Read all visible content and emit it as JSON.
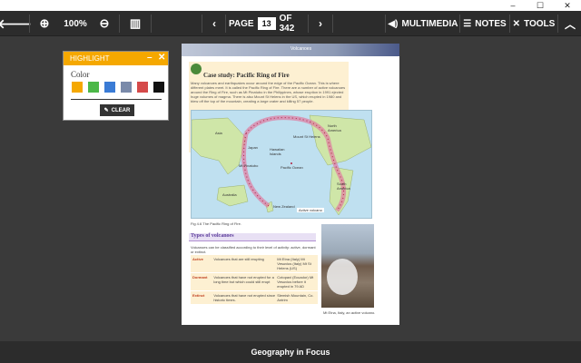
{
  "window": {
    "minimize": "–",
    "maximize": "☐",
    "close": "✕"
  },
  "toolbar": {
    "back": "🡐",
    "zoom_in": "⊕",
    "zoom_level": "100%",
    "zoom_out": "⊖",
    "book_view": "▥",
    "page_label": "PAGE",
    "page_number": "13",
    "page_of": "OF 342",
    "multimedia": "MULTIMEDIA",
    "notes": "NOTES",
    "tools": "TOOLS"
  },
  "highlight": {
    "title": "HIGHLIGHT",
    "color_label": "Color",
    "colors": [
      "#f5a800",
      "#4cb848",
      "#3a7bd5",
      "#7a8aaa",
      "#d54a4a",
      "#111111"
    ],
    "clear_label": "CLEAR"
  },
  "book": {
    "banner": "Volcanoes",
    "cs_title": "Case study: Pacific Ring of Fire",
    "cs_text": "Many volcanoes and earthquakes occur around the edge of the Pacific Ocean. This is where different plates meet. It is called the Pacific Ring of Fire. There are a number of active volcanoes around the Ring of Fire, such as Mt Pinatubo in the Philippines, whose eruption in 1991 ejected huge volumes of magma. There is also Mount St Helens in the US, which erupted in 1980 and blew off the top of the mountain, creating a large crater and killing 57 people.",
    "map_labels": [
      "Asia",
      "North America",
      "Mount St Helens",
      "Hawaiian Islands",
      "Pacific Ocean",
      "Mt Pinatubo",
      "Japan",
      "South America",
      "Australia",
      "New Zealand",
      "Active volcano"
    ],
    "fig_caption": "Fig 4.6 The Pacific Ring of Fire.",
    "tv_title": "Types of volcanoes",
    "tv_intro": "Volcanoes can be classified according to their level of activity: active, dormant or extinct.",
    "table": [
      {
        "type": "Active",
        "desc": "Volcanoes that are still erupting",
        "examples": "Mt Etna (Italy) Mt Vesuvius (Italy) Mt St Helens (US)"
      },
      {
        "type": "Dormant",
        "desc": "Volcanoes that have not erupted for a long time but which could still erupt",
        "examples": "Cotopaxi (Ecuador) Mt Vesuvius before it erupted in 79 AD"
      },
      {
        "type": "Extinct",
        "desc": "Volcanoes that have not erupted since historic times.",
        "examples": "Slemish Mountain, Co. Antrim"
      }
    ],
    "photo_caption": "Mt Etna, Italy, an active volcano."
  },
  "footer": {
    "title": "Geography in Focus"
  }
}
